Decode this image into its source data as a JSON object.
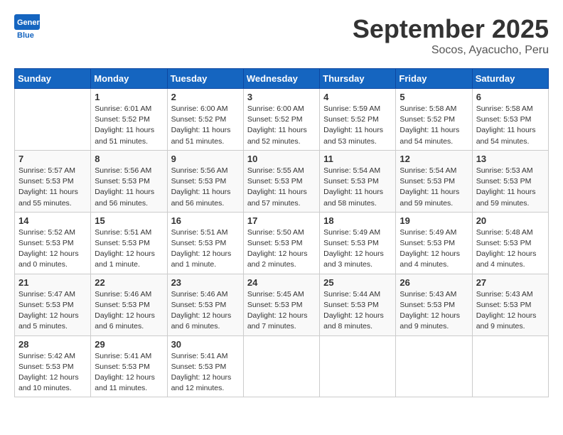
{
  "header": {
    "logo_general": "General",
    "logo_blue": "Blue",
    "month": "September 2025",
    "location": "Socos, Ayacucho, Peru"
  },
  "days_of_week": [
    "Sunday",
    "Monday",
    "Tuesday",
    "Wednesday",
    "Thursday",
    "Friday",
    "Saturday"
  ],
  "weeks": [
    [
      {
        "day": "",
        "info": ""
      },
      {
        "day": "1",
        "info": "Sunrise: 6:01 AM\nSunset: 5:52 PM\nDaylight: 11 hours\nand 51 minutes."
      },
      {
        "day": "2",
        "info": "Sunrise: 6:00 AM\nSunset: 5:52 PM\nDaylight: 11 hours\nand 51 minutes."
      },
      {
        "day": "3",
        "info": "Sunrise: 6:00 AM\nSunset: 5:52 PM\nDaylight: 11 hours\nand 52 minutes."
      },
      {
        "day": "4",
        "info": "Sunrise: 5:59 AM\nSunset: 5:52 PM\nDaylight: 11 hours\nand 53 minutes."
      },
      {
        "day": "5",
        "info": "Sunrise: 5:58 AM\nSunset: 5:52 PM\nDaylight: 11 hours\nand 54 minutes."
      },
      {
        "day": "6",
        "info": "Sunrise: 5:58 AM\nSunset: 5:53 PM\nDaylight: 11 hours\nand 54 minutes."
      }
    ],
    [
      {
        "day": "7",
        "info": "Sunrise: 5:57 AM\nSunset: 5:53 PM\nDaylight: 11 hours\nand 55 minutes."
      },
      {
        "day": "8",
        "info": "Sunrise: 5:56 AM\nSunset: 5:53 PM\nDaylight: 11 hours\nand 56 minutes."
      },
      {
        "day": "9",
        "info": "Sunrise: 5:56 AM\nSunset: 5:53 PM\nDaylight: 11 hours\nand 56 minutes."
      },
      {
        "day": "10",
        "info": "Sunrise: 5:55 AM\nSunset: 5:53 PM\nDaylight: 11 hours\nand 57 minutes."
      },
      {
        "day": "11",
        "info": "Sunrise: 5:54 AM\nSunset: 5:53 PM\nDaylight: 11 hours\nand 58 minutes."
      },
      {
        "day": "12",
        "info": "Sunrise: 5:54 AM\nSunset: 5:53 PM\nDaylight: 11 hours\nand 59 minutes."
      },
      {
        "day": "13",
        "info": "Sunrise: 5:53 AM\nSunset: 5:53 PM\nDaylight: 11 hours\nand 59 minutes."
      }
    ],
    [
      {
        "day": "14",
        "info": "Sunrise: 5:52 AM\nSunset: 5:53 PM\nDaylight: 12 hours\nand 0 minutes."
      },
      {
        "day": "15",
        "info": "Sunrise: 5:51 AM\nSunset: 5:53 PM\nDaylight: 12 hours\nand 1 minute."
      },
      {
        "day": "16",
        "info": "Sunrise: 5:51 AM\nSunset: 5:53 PM\nDaylight: 12 hours\nand 1 minute."
      },
      {
        "day": "17",
        "info": "Sunrise: 5:50 AM\nSunset: 5:53 PM\nDaylight: 12 hours\nand 2 minutes."
      },
      {
        "day": "18",
        "info": "Sunrise: 5:49 AM\nSunset: 5:53 PM\nDaylight: 12 hours\nand 3 minutes."
      },
      {
        "day": "19",
        "info": "Sunrise: 5:49 AM\nSunset: 5:53 PM\nDaylight: 12 hours\nand 4 minutes."
      },
      {
        "day": "20",
        "info": "Sunrise: 5:48 AM\nSunset: 5:53 PM\nDaylight: 12 hours\nand 4 minutes."
      }
    ],
    [
      {
        "day": "21",
        "info": "Sunrise: 5:47 AM\nSunset: 5:53 PM\nDaylight: 12 hours\nand 5 minutes."
      },
      {
        "day": "22",
        "info": "Sunrise: 5:46 AM\nSunset: 5:53 PM\nDaylight: 12 hours\nand 6 minutes."
      },
      {
        "day": "23",
        "info": "Sunrise: 5:46 AM\nSunset: 5:53 PM\nDaylight: 12 hours\nand 6 minutes."
      },
      {
        "day": "24",
        "info": "Sunrise: 5:45 AM\nSunset: 5:53 PM\nDaylight: 12 hours\nand 7 minutes."
      },
      {
        "day": "25",
        "info": "Sunrise: 5:44 AM\nSunset: 5:53 PM\nDaylight: 12 hours\nand 8 minutes."
      },
      {
        "day": "26",
        "info": "Sunrise: 5:43 AM\nSunset: 5:53 PM\nDaylight: 12 hours\nand 9 minutes."
      },
      {
        "day": "27",
        "info": "Sunrise: 5:43 AM\nSunset: 5:53 PM\nDaylight: 12 hours\nand 9 minutes."
      }
    ],
    [
      {
        "day": "28",
        "info": "Sunrise: 5:42 AM\nSunset: 5:53 PM\nDaylight: 12 hours\nand 10 minutes."
      },
      {
        "day": "29",
        "info": "Sunrise: 5:41 AM\nSunset: 5:53 PM\nDaylight: 12 hours\nand 11 minutes."
      },
      {
        "day": "30",
        "info": "Sunrise: 5:41 AM\nSunset: 5:53 PM\nDaylight: 12 hours\nand 12 minutes."
      },
      {
        "day": "",
        "info": ""
      },
      {
        "day": "",
        "info": ""
      },
      {
        "day": "",
        "info": ""
      },
      {
        "day": "",
        "info": ""
      }
    ]
  ]
}
